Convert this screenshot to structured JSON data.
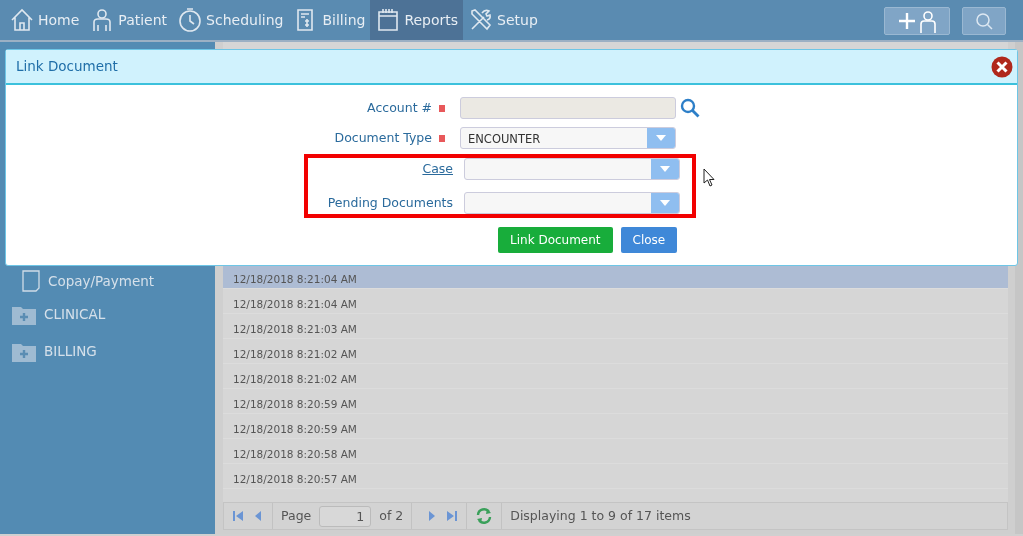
{
  "nav": [
    {
      "label": "Home",
      "selected": false
    },
    {
      "label": "Patient",
      "selected": false
    },
    {
      "label": "Scheduling",
      "selected": false
    },
    {
      "label": "Billing",
      "selected": false
    },
    {
      "label": "Reports",
      "selected": true
    },
    {
      "label": "Setup",
      "selected": false
    }
  ],
  "sidebar": {
    "items": [
      {
        "label": "Copay/Payment",
        "kind": "document"
      },
      {
        "label": "CLINICAL",
        "kind": "folder"
      },
      {
        "label": "BILLING",
        "kind": "folder"
      }
    ]
  },
  "table": {
    "rows": [
      {
        "date": "12/18/2018 8:21:04 AM",
        "selected": true
      },
      {
        "date": "12/18/2018 8:21:04 AM",
        "selected": false
      },
      {
        "date": "12/18/2018 8:21:03 AM",
        "selected": false
      },
      {
        "date": "12/18/2018 8:21:02 AM",
        "selected": false
      },
      {
        "date": "12/18/2018 8:21:02 AM",
        "selected": false
      },
      {
        "date": "12/18/2018 8:20:59 AM",
        "selected": false
      },
      {
        "date": "12/18/2018 8:20:59 AM",
        "selected": false
      },
      {
        "date": "12/18/2018 8:20:58 AM",
        "selected": false
      },
      {
        "date": "12/18/2018 8:20:57 AM",
        "selected": false
      }
    ]
  },
  "pager": {
    "page_label": "Page",
    "page": "1",
    "of": "of 2",
    "summary": "Displaying 1 to 9 of 17 items"
  },
  "modal": {
    "title": "Link Document",
    "fields": [
      {
        "label": "Account #",
        "kind": "lookup",
        "required": true,
        "link": false,
        "highlighted": false,
        "disabled": true
      },
      {
        "label": "Document Type",
        "kind": "select",
        "value": "ENCOUNTER",
        "required": true,
        "link": false,
        "highlighted": false,
        "disabled": false
      },
      {
        "label": "Case",
        "kind": "select",
        "required": false,
        "link": true,
        "highlighted": true,
        "disabled": false
      },
      {
        "label": "Pending Documents",
        "kind": "select",
        "required": false,
        "link": false,
        "highlighted": true,
        "disabled": false
      }
    ],
    "buttons": [
      {
        "label": "Link Document",
        "kind": "primary"
      },
      {
        "label": "Close",
        "kind": "secondary"
      }
    ]
  }
}
